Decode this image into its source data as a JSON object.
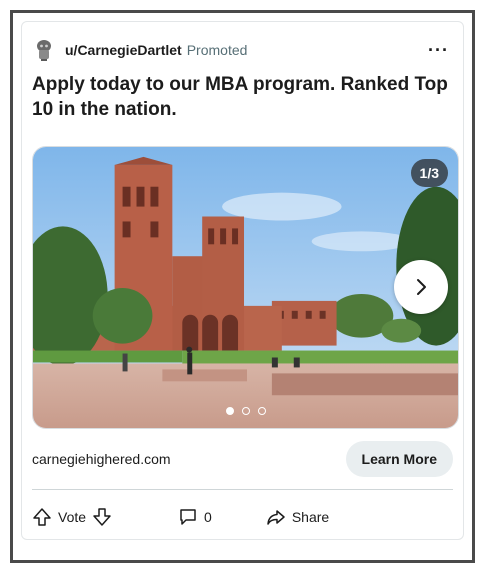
{
  "post": {
    "username": "u/CarnegieDartlet",
    "promoted_label": "Promoted",
    "more_glyph": "···",
    "title": "Apply today to our MBA program. Ranked Top 10 in the nation."
  },
  "media": {
    "counter": "1/3",
    "current_slide": 1,
    "total_slides": 3
  },
  "link": {
    "domain": "carnegiehighered.com",
    "cta_label": "Learn More"
  },
  "actions": {
    "vote_label": "Vote",
    "comment_count": "0",
    "share_label": "Share"
  },
  "icons": {
    "avatar": "robot-avatar-icon",
    "next": "chevron-right-icon",
    "upvote": "arrow-up-icon",
    "downvote": "arrow-down-icon",
    "comment": "comment-bubble-icon",
    "share": "share-arrow-icon"
  }
}
